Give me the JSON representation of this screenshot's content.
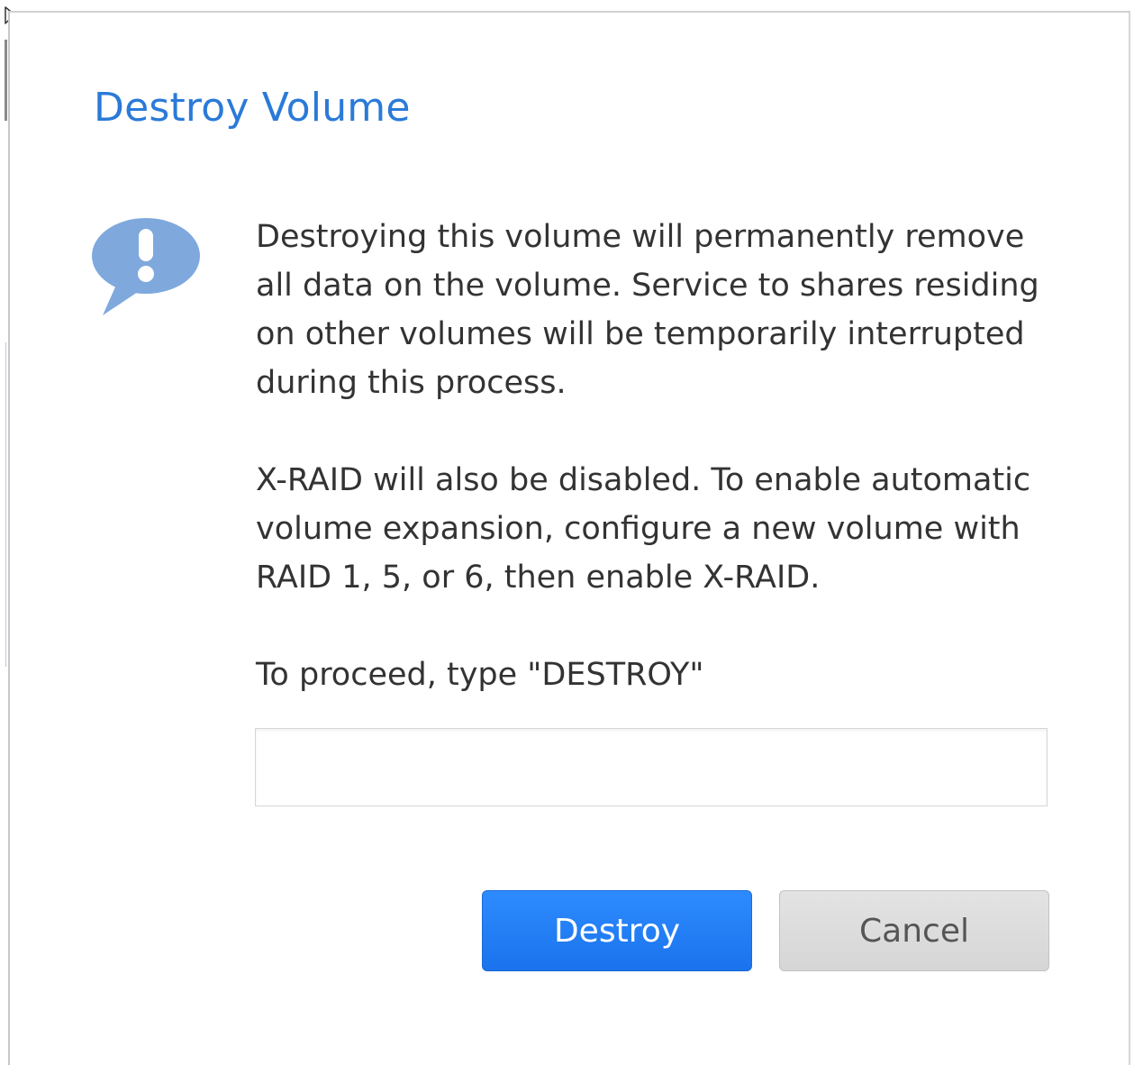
{
  "dialog": {
    "title": "Destroy Volume",
    "icon": "alert-speech-bubble-icon",
    "message_paragraphs": [
      "Destroying this volume will permanently remove all data on the volume. Service to shares residing on other volumes will be temporarily interrupted during this process.",
      "X-RAID will also be disabled. To enable automatic volume expansion, configure a new volume with RAID 1, 5, or 6, then enable X-RAID."
    ],
    "confirm_prompt": "To proceed, type \"DESTROY\"",
    "confirm_input": {
      "value": "",
      "placeholder": ""
    },
    "buttons": {
      "destroy_label": "Destroy",
      "cancel_label": "Cancel"
    }
  },
  "colors": {
    "title": "#2a7ad8",
    "icon": "#7fa9dd",
    "primary_button": "#1f7ff5",
    "secondary_button": "#dcdcdc",
    "body_text": "#333333"
  }
}
